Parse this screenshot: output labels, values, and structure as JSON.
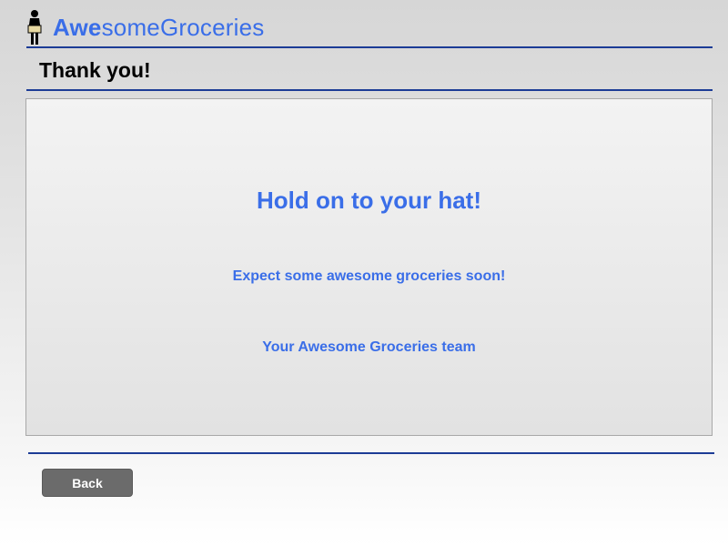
{
  "header": {
    "brand_bold": "Awe",
    "brand_rest": "someGroceries"
  },
  "page": {
    "title": "Thank you!"
  },
  "main": {
    "headline": "Hold on to your hat!",
    "message": "Expect some awesome groceries soon!",
    "signature": "Your Awesome Groceries team"
  },
  "footer": {
    "back_label": "Back"
  },
  "icons": {
    "logo": "grocer-figure-icon"
  },
  "colors": {
    "brand": "#3a6ee8",
    "rule": "#1c3c96",
    "button": "#6b6b6b"
  }
}
